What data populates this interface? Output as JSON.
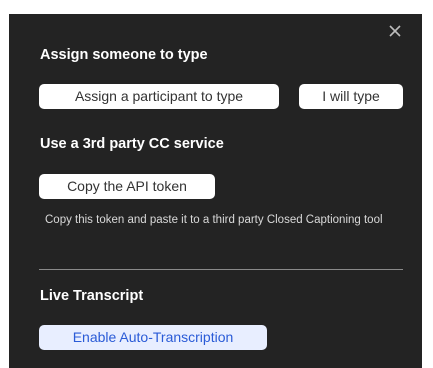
{
  "popup": {
    "close_icon": "close-icon"
  },
  "assign_section": {
    "title": "Assign someone to type",
    "assign_participant_label": "Assign a participant to type",
    "i_will_type_label": "I will type"
  },
  "third_party_section": {
    "title": "Use a 3rd party CC service",
    "copy_token_label": "Copy the API token",
    "help_text": "Copy this token and paste it to a third party Closed Captioning tool"
  },
  "live_transcript_section": {
    "title": "Live Transcript",
    "enable_auto_transcription_label": "Enable Auto-Transcription"
  },
  "colors": {
    "popup_background": "#232323",
    "button_background": "#ffffff",
    "link_button_background": "#e8eeff",
    "link_button_text": "#2a5bd7"
  }
}
